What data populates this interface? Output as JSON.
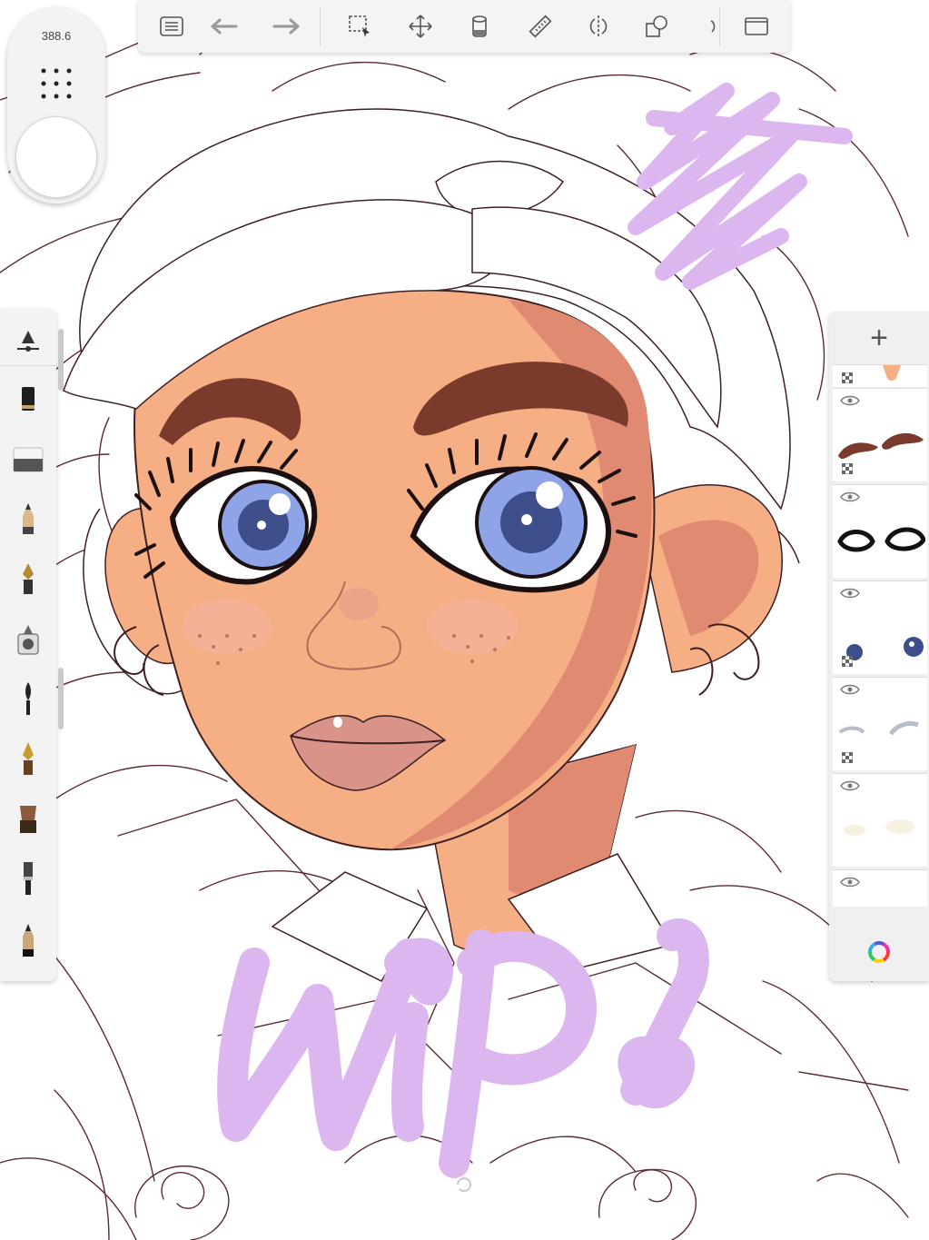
{
  "brush_puck": {
    "size_value": "388.6"
  },
  "toolbar": {
    "items": [
      "gallery",
      "undo",
      "redo",
      "selection",
      "transform",
      "fill",
      "ruler",
      "symmetry",
      "layers-stack",
      "fullscreen"
    ]
  },
  "canvas": {
    "wip_text": "WIP!"
  },
  "brush_palette": {
    "items": [
      "brush-settings",
      "marker",
      "eraser",
      "pencil",
      "ink-pen",
      "airbrush",
      "paint-brush",
      "calligraphy-pen",
      "hard-brush",
      "flat-brush",
      "pencil-dark"
    ]
  },
  "layers": {
    "add_label": "+",
    "items": [
      "skin",
      "eyebrows",
      "eyelashes",
      "irises",
      "eye-shadow",
      "highlights",
      "sketch"
    ]
  },
  "colors": {
    "wip_purple": "#dcb6ef",
    "skin": "#f6ae84",
    "skin_shadow": "#df8a71",
    "brow": "#7a3a2c",
    "iris": "#8ea4e6",
    "line": "#4b2327"
  }
}
